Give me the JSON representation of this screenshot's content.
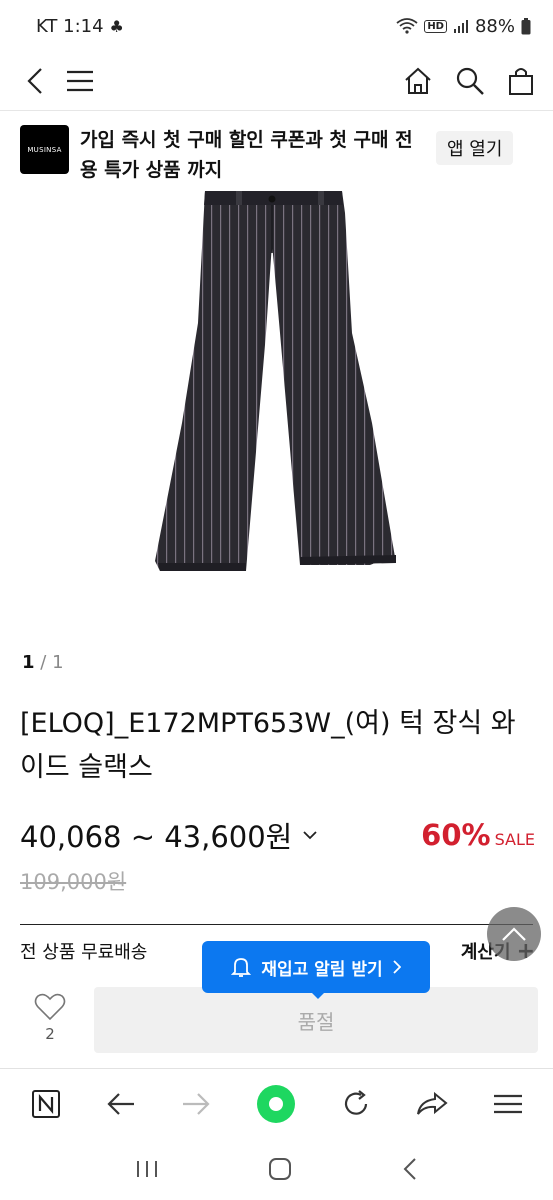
{
  "status_bar": {
    "carrier_time": "KT 1:14",
    "battery": "88%"
  },
  "app_banner": {
    "logo_text": "MUSINSA",
    "text": "가입 즉시 첫 구매 할인 쿠폰과 첫 구매 전용 특가 상품 까지",
    "open_app_label": "앱 열기"
  },
  "gallery": {
    "current": "1",
    "separator": "/",
    "total": "1"
  },
  "product": {
    "title": "[ELOQ]_E172MPT653W_(여) 턱 장식 와이드 슬랙스",
    "price": "40,068 ~ 43,600원",
    "discount_percent": "60%",
    "sale_label": "SALE",
    "original_price": "109,000원"
  },
  "shipping": {
    "free_shipping_label": "전 상품 무료배송",
    "calculator_label": "계산기"
  },
  "restock_button": {
    "label": "재입고 알림 받기"
  },
  "purchase_bar": {
    "like_count": "2",
    "soldout_label": "품절"
  },
  "colors": {
    "accent_blue": "#0c78f0",
    "sale_red": "#d2202f",
    "pinstripe_fabric": "#2b2a30",
    "nav_green": "#1ed760"
  }
}
